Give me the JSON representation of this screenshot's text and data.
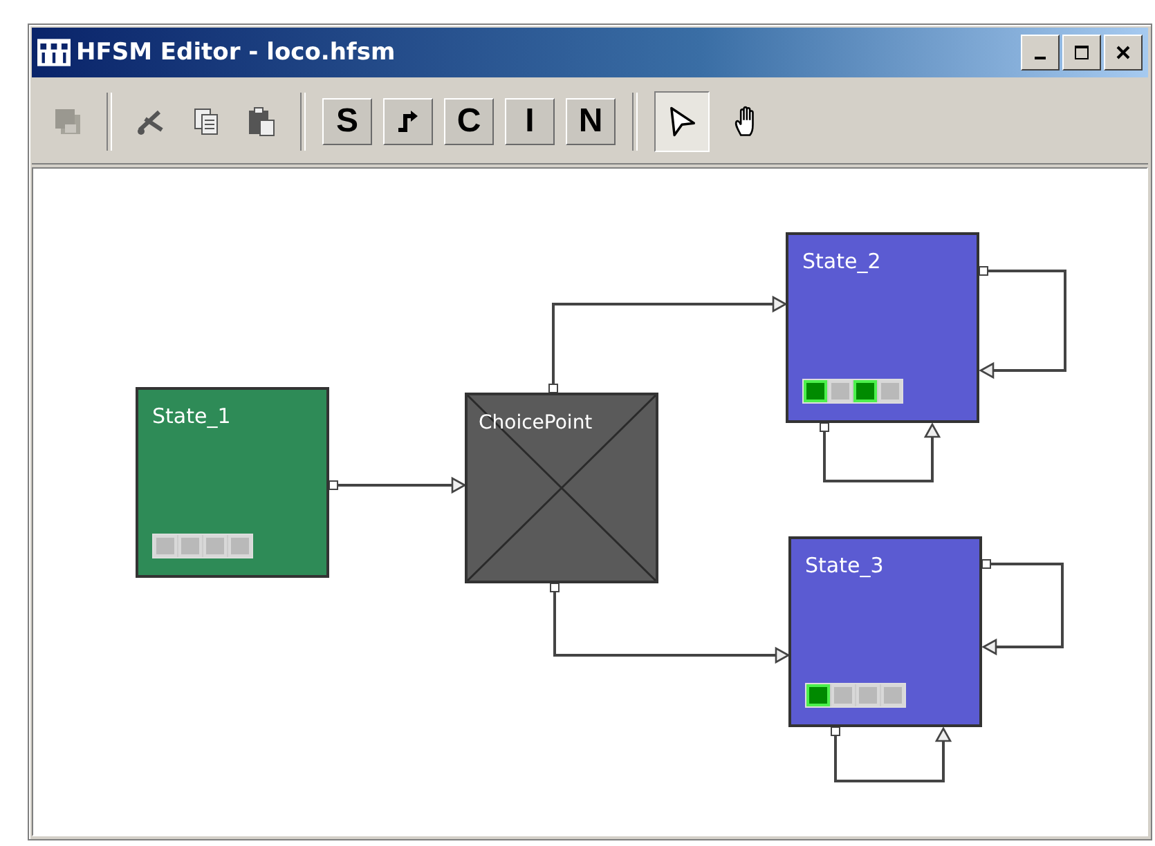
{
  "window": {
    "title": "HFSM Editor - loco.hfsm"
  },
  "toolbar": {
    "edit_tools": [
      {
        "kind": "save",
        "disabled": true
      },
      {
        "kind": "cut",
        "disabled": false
      },
      {
        "kind": "copy",
        "disabled": false
      },
      {
        "kind": "paste",
        "disabled": false
      }
    ],
    "element_tools": [
      {
        "kind": "letter",
        "label": "S"
      },
      {
        "kind": "transition"
      },
      {
        "kind": "letter",
        "label": "C"
      },
      {
        "kind": "letter",
        "label": "I"
      },
      {
        "kind": "letter",
        "label": "N"
      }
    ],
    "mode_tools": [
      {
        "kind": "pointer",
        "selected": true
      },
      {
        "kind": "hand",
        "selected": false
      }
    ]
  },
  "diagram": {
    "nodes": [
      {
        "kind": "state",
        "name": "State_1",
        "color": "#2e8b57",
        "flags": [
          {
            "on": false
          },
          {
            "on": false
          },
          {
            "on": false
          },
          {
            "on": false
          }
        ]
      },
      {
        "kind": "choice",
        "name": "ChoicePoint",
        "color": "#5a5a5a"
      },
      {
        "kind": "state",
        "name": "State_2",
        "color": "#5b5bd2",
        "flags": [
          {
            "on": true
          },
          {
            "on": false
          },
          {
            "on": true
          },
          {
            "on": false
          }
        ]
      },
      {
        "kind": "state",
        "name": "State_3",
        "color": "#5b5bd2",
        "flags": [
          {
            "on": true
          },
          {
            "on": false
          },
          {
            "on": false
          },
          {
            "on": false
          }
        ]
      }
    ]
  }
}
